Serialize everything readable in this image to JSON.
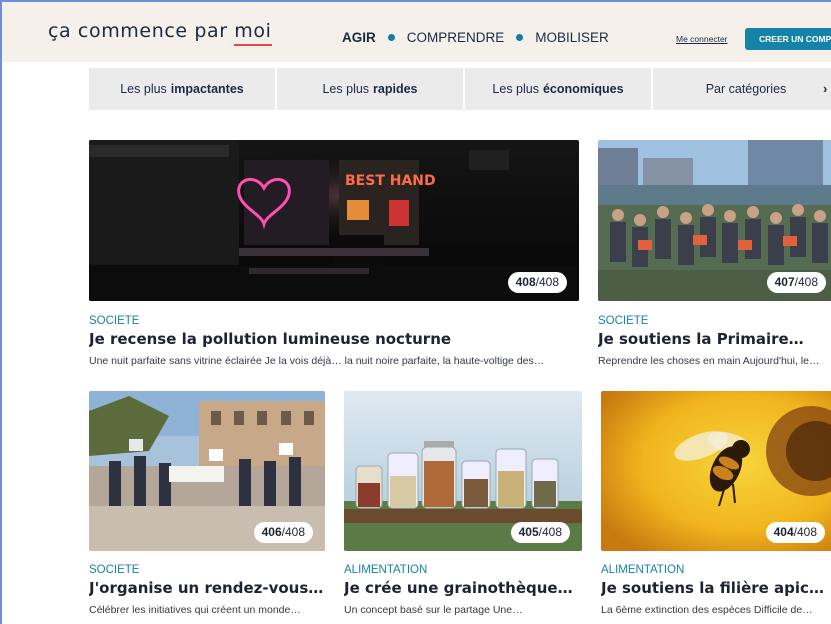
{
  "header": {
    "logo": {
      "before": "ça commence par ",
      "underlined": "moi"
    },
    "nav": [
      "AGIR",
      "COMPRENDRE",
      "MOBILISER"
    ],
    "login_label": "Me connecter",
    "signup_label": "CREER UN COMPTE"
  },
  "tabs": [
    {
      "prefix": "Les plus",
      "bold": "impactantes"
    },
    {
      "prefix": "Les plus",
      "bold": "rapides"
    },
    {
      "prefix": "Les plus",
      "bold": "économiques"
    },
    {
      "prefix": "Par catégories",
      "bold": ""
    }
  ],
  "cards": [
    {
      "rank": "408",
      "total": "/408",
      "category": "SOCIETE",
      "title": "Je recense la pollution lumineuse nocturne",
      "description": "Une nuit parfaite sans vitrine éclairée Je la vois déjà… la nuit noire parfaite, la haute-voltige des…"
    },
    {
      "rank": "407",
      "total": "/408",
      "category": "SOCIETE",
      "title": "Je soutiens la Primaire…",
      "description": "Reprendre les choses en main Aujourd'hui, le…"
    },
    {
      "rank": "406",
      "total": "/408",
      "category": "SOCIETE",
      "title": "J'organise un rendez-vous …",
      "description": "Célébrer les initiatives qui créent un monde…"
    },
    {
      "rank": "405",
      "total": "/408",
      "category": "ALIMENTATION",
      "title": "Je crée une grainothèque…",
      "description": "Un concept basé sur le partage Une…"
    },
    {
      "rank": "404",
      "total": "/408",
      "category": "ALIMENTATION",
      "title": "Je soutiens la filière apicol…",
      "description": "La 6ème extinction des espèces Difficile de…"
    }
  ],
  "colors": {
    "accent": "#1582a8",
    "header_bg": "#f5f1ea",
    "tab_bg": "#ecebeb",
    "logo_underline": "#e5484d"
  }
}
